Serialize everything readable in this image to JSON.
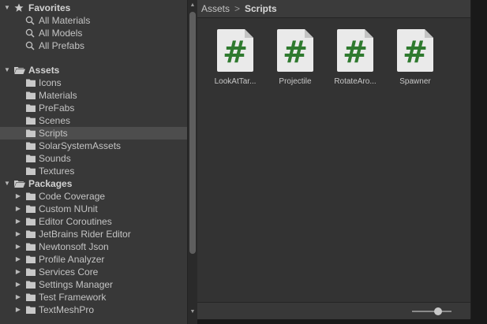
{
  "sidebar": {
    "favorites": {
      "label": "Favorites",
      "items": [
        "All Materials",
        "All Models",
        "All Prefabs"
      ]
    },
    "assets": {
      "label": "Assets",
      "items": [
        "Icons",
        "Materials",
        "PreFabs",
        "Scenes",
        "Scripts",
        "SolarSystemAssets",
        "Sounds",
        "Textures"
      ],
      "selected": "Scripts"
    },
    "packages": {
      "label": "Packages",
      "items": [
        "Code Coverage",
        "Custom NUnit",
        "Editor Coroutines",
        "JetBrains Rider Editor",
        "Newtonsoft Json",
        "Profile Analyzer",
        "Services Core",
        "Settings Manager",
        "Test Framework",
        "TextMeshPro"
      ]
    }
  },
  "breadcrumb": {
    "root": "Assets",
    "separator": ">",
    "current": "Scripts"
  },
  "assets_grid": [
    {
      "name": "LookAtTar...",
      "icon_glyph": "#"
    },
    {
      "name": "Projectile",
      "icon_glyph": "#"
    },
    {
      "name": "RotateAro...",
      "icon_glyph": "#"
    },
    {
      "name": "Spawner",
      "icon_glyph": "#"
    }
  ],
  "colors": {
    "script_glyph": "#2f7a2f",
    "selection": "#4d4d4d",
    "panel": "#383838",
    "content": "#333333"
  }
}
